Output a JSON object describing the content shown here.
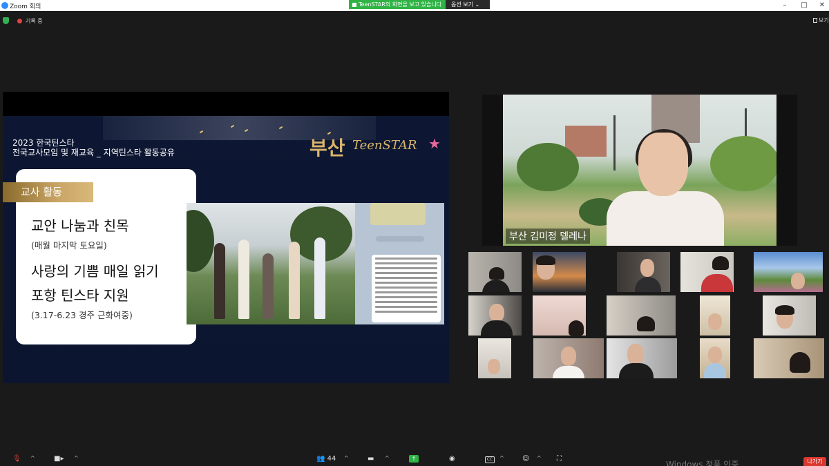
{
  "window": {
    "title": "Zoom 회의",
    "share_banner": "TeenSTAR의 화면을 보고 있습니다",
    "view_options": "옵션 보기 ⌄"
  },
  "status": {
    "recording": "기록 중",
    "view": "보기"
  },
  "slide": {
    "conf_year": "2023 한국틴스타",
    "conf_title": "전국교사모임 및 재교육 _ 지역틴스타 활동공유",
    "brand_city": "부산",
    "brand_name": "TeenSTAR",
    "badge": "교사 활동",
    "heading1": "교안 나눔과 친목",
    "sub1": "(매월 마지막 토요일)",
    "heading2": "사랑의 기쁨 매일 읽기",
    "heading3": "포항 틴스타 지원",
    "sub2": "(3.17-6.23 경주 근화여중)"
  },
  "speaker": {
    "name_label": "부산 김미정 델레나"
  },
  "toolbar": {
    "participants_count": "44",
    "leave": "나가기"
  },
  "watermark": "Windows 정품 인증",
  "colors": {
    "share_green": "#2fb344",
    "leave_red": "#d9372f",
    "slide_navy": "#0d1733",
    "brand_gold": "#d9b46a"
  }
}
